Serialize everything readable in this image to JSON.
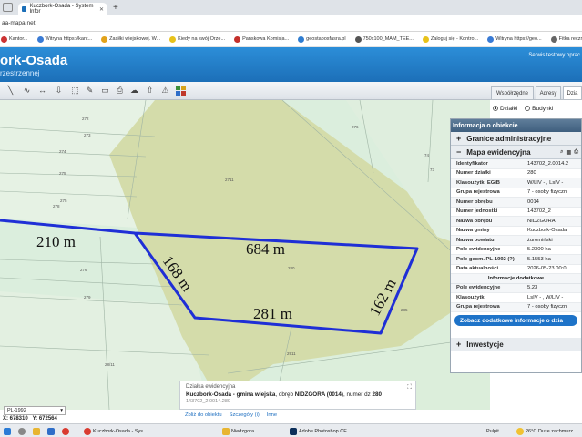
{
  "browser": {
    "tab_title": "Kuczbork-Osada - System Infor",
    "address": "aa-mapa.net",
    "bookmarks": [
      {
        "label": "Kantor...",
        "color": "#cc3333"
      },
      {
        "label": "Witryna https://kant...",
        "color": "#3a7bd5"
      },
      {
        "label": "Zasiłki wiejskowej. W...",
        "color": "#e2a21a"
      },
      {
        "label": "Kiedy na swój Orze...",
        "color": "#e8c21a"
      },
      {
        "label": "Pańskowa Komisja...",
        "color": "#c4302b"
      },
      {
        "label": "geostaposfasra.pl",
        "color": "#2f7dd1"
      },
      {
        "label": "750x100_MAM_TEE...",
        "color": "#555555"
      },
      {
        "label": "Zaloguj się - Kontro...",
        "color": "#e8c21a"
      },
      {
        "label": "Witryna https://geo...",
        "color": "#3a7bd5"
      },
      {
        "label": "Fitka reczna-wymi...",
        "color": "#666666"
      }
    ]
  },
  "app": {
    "title": "ork-Osada",
    "subtitle": "rzestrzennej",
    "test_notice": "Serwis testowy oprac"
  },
  "side_tabs": [
    "Współrzędne",
    "Adresy",
    "Dzia"
  ],
  "layer_radio": {
    "option1": "Działki",
    "option2": "Budynki"
  },
  "map": {
    "measurements": [
      "210 m",
      "684 m",
      "168 m",
      "162 m",
      "281 m"
    ],
    "parcel_numbers": [
      "272",
      "273",
      "274",
      "275",
      "278",
      "275",
      "276",
      "279",
      "280",
      "2911",
      "28/11",
      "285",
      "74",
      "73",
      "2711",
      "276"
    ]
  },
  "info_panel": {
    "header": "Informacja o obiekcie",
    "section_admin": "Granice administracyjne",
    "section_map": "Mapa ewidencyjna",
    "rows": [
      {
        "k": "Identyfikator",
        "v": "143702_2.0014.2"
      },
      {
        "k": "Numer działki",
        "v": "280"
      },
      {
        "k": "Klasoużytki EGiB",
        "v": "W/LIV - , LsIV -"
      },
      {
        "k": "Grupa rejestrowa",
        "v": "7 - osoby fizyczn"
      },
      {
        "k": "Numer obrębu",
        "v": "0014"
      },
      {
        "k": "Numer jednostki",
        "v": "143702_2"
      },
      {
        "k": "Nazwa obrębu",
        "v": "NIDZGORA"
      },
      {
        "k": "Nazwa gminy",
        "v": "Kuczbork-Osada"
      },
      {
        "k": "Nazwa powiatu",
        "v": "żuromiński"
      },
      {
        "k": "Pole ewidencyjne",
        "v": "5.2300 ha"
      },
      {
        "k": "Pole geom. PL-1992 (?)",
        "v": "5.1553 ha"
      },
      {
        "k": "Data aktualności",
        "v": "2026-05-23 00:0"
      }
    ],
    "extra_header": "Informacje dodatkowe",
    "extra_rows": [
      {
        "k": "Pole ewidencyjne",
        "v": "5.23"
      },
      {
        "k": "Klasoużytki",
        "v": "LsIV - , W/LIV -"
      },
      {
        "k": "Grupa rejestrowa",
        "v": "7 - osoby fizyczn"
      }
    ],
    "more_button": "Zobacz dodatkowe informacje o dzia",
    "section_invest": "Inwestycje"
  },
  "popup": {
    "title": "Działka ewidencyjna",
    "main_bold": "Kuczbork-Osada - gmina wiejska",
    "main_mid": ", obręb",
    "main_bold2": "NIDZGORA (0014)",
    "main_tail": ", numer dz",
    "main_num": "280",
    "id": "143702_2.0014.280",
    "link1": "Zbliż do obiektu",
    "link2": "Szczegóły (i)",
    "link3": "Inne"
  },
  "crs": "PL-1992",
  "coords": {
    "x": "X: 678310",
    "y": "Y: 672564"
  },
  "taskbar": {
    "items": [
      "Kuczbork-Osada - Sys...",
      "Niedzgora",
      "Adobe Photoshop CE"
    ],
    "weather": "26°C  Duże zachmurz",
    "lang": "Pulpit"
  }
}
